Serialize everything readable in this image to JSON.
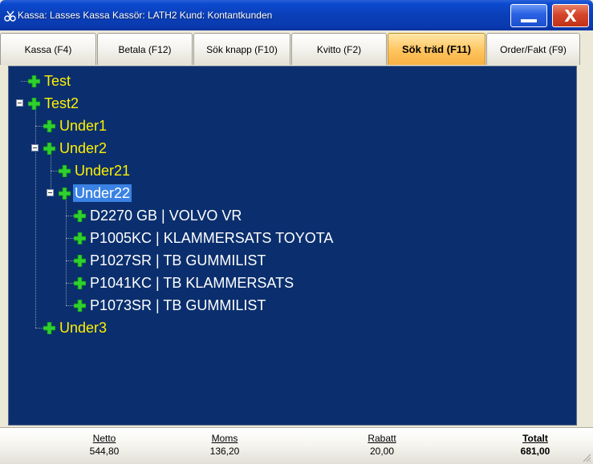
{
  "window": {
    "title": "Kassa: Lasses Kassa  Kassör: LATH2  Kund: Kontantkunden",
    "close_glyph": "X"
  },
  "tabs": [
    {
      "label": "Kassa (F4)",
      "active": false
    },
    {
      "label": "Betala (F12)",
      "active": false
    },
    {
      "label": "Sök knapp (F10)",
      "active": false
    },
    {
      "label": "Kvitto (F2)",
      "active": false
    },
    {
      "label": "Sök träd (F11)",
      "active": true
    },
    {
      "label": "Order/Fakt (F9)",
      "active": false
    }
  ],
  "tree": {
    "nodes": [
      {
        "label": "Test",
        "kind": "group",
        "level": 0,
        "expanded": false
      },
      {
        "label": "Test2",
        "kind": "group",
        "level": 0,
        "expanded": true
      },
      {
        "label": "Under1",
        "kind": "group",
        "level": 1,
        "expanded": false
      },
      {
        "label": "Under2",
        "kind": "group",
        "level": 1,
        "expanded": true
      },
      {
        "label": "Under21",
        "kind": "group",
        "level": 2,
        "expanded": false
      },
      {
        "label": "Under22",
        "kind": "group",
        "level": 2,
        "expanded": true,
        "selected": true
      },
      {
        "label": "D2270 GB | VOLVO VR",
        "kind": "item",
        "level": 3
      },
      {
        "label": "P1005KC | KLAMMERSATS TOYOTA",
        "kind": "item",
        "level": 3
      },
      {
        "label": "P1027SR | TB GUMMILIST",
        "kind": "item",
        "level": 3
      },
      {
        "label": "P1041KC | TB KLAMMERSATS",
        "kind": "item",
        "level": 3
      },
      {
        "label": "P1073SR | TB GUMMILIST",
        "kind": "item",
        "level": 3
      },
      {
        "label": "Under3",
        "kind": "group",
        "level": 1,
        "expanded": false
      }
    ]
  },
  "totals": {
    "netto": {
      "label": "Netto",
      "value": "544,80"
    },
    "moms": {
      "label": "Moms",
      "value": "136,20"
    },
    "rabatt": {
      "label": "Rabatt",
      "value": "20,00"
    },
    "totalt": {
      "label": "Totalt",
      "value": "681,00"
    }
  },
  "colors": {
    "tree_background": "#0B2F6E",
    "group_text": "#FFF000",
    "item_text": "#FFFFFF",
    "selection": "#3A82E4",
    "plus_icon": "#2FD12F",
    "active_tab": "#FFC45E"
  }
}
